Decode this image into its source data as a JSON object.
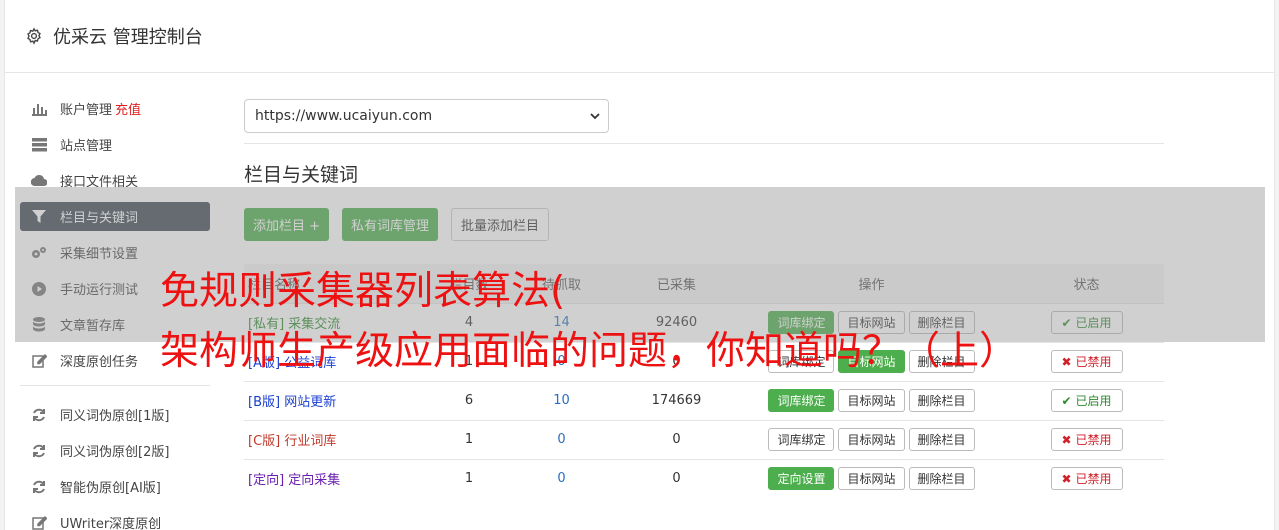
{
  "header": {
    "title": "优采云 管理控制台"
  },
  "sidebar": {
    "items": [
      {
        "label": "账户管理",
        "extra": "充值",
        "icon": "bar-chart-icon"
      },
      {
        "label": "站点管理",
        "icon": "server-icon"
      },
      {
        "label": "接口文件相关",
        "icon": "cloud-upload-icon"
      },
      {
        "label": "栏目与关键词",
        "icon": "filter-icon",
        "active": true
      },
      {
        "label": "采集细节设置",
        "icon": "cogs-icon"
      },
      {
        "label": "手动运行测试",
        "icon": "play-circle-icon"
      },
      {
        "label": "文章暂存库",
        "icon": "database-icon"
      },
      {
        "label": "深度原创任务",
        "icon": "edit-icon"
      }
    ],
    "items2": [
      {
        "label": "同义词伪原创[1版]",
        "icon": "refresh-icon"
      },
      {
        "label": "同义词伪原创[2版]",
        "icon": "refresh-icon"
      },
      {
        "label": "智能伪原创[AI版]",
        "icon": "refresh-icon"
      },
      {
        "label": "UWriter深度原创",
        "icon": "edit-icon"
      }
    ]
  },
  "main": {
    "site_select": "https://www.ucaiyun.com",
    "section_title": "栏目与关键词",
    "buttons": {
      "add": "添加栏目 +",
      "private": "私有词库管理",
      "batch": "批量添加栏目"
    },
    "table": {
      "headers": [
        "栏目名称",
        "栏目数",
        "待抓取",
        "已采集",
        "操作",
        "状态"
      ],
      "rows": [
        {
          "tag": "[私有]",
          "name": "采集交流",
          "cols": "4",
          "pending": "14",
          "collected": "92460",
          "op1": "词库绑定",
          "op2": "目标网站",
          "op3": "删除栏目",
          "status": "已启用"
        },
        {
          "tag": "[A版]",
          "name": "公益词库",
          "cols": "1",
          "pending": "0",
          "collected": "0",
          "op1": "词库绑定",
          "op2": "目标网站",
          "op3": "删除栏目",
          "status": "已禁用"
        },
        {
          "tag": "[B版]",
          "name": "网站更新",
          "cols": "6",
          "pending": "10",
          "collected": "174669",
          "op1": "词库绑定",
          "op2": "目标网站",
          "op3": "删除栏目",
          "status": "已启用"
        },
        {
          "tag": "[C版]",
          "name": "行业词库",
          "cols": "1",
          "pending": "0",
          "collected": "0",
          "op1": "词库绑定",
          "op2": "目标网站",
          "op3": "删除栏目",
          "status": "已禁用"
        },
        {
          "tag": "[定向]",
          "name": "定向采集",
          "cols": "1",
          "pending": "0",
          "collected": "0",
          "op1": "定向设置",
          "op2": "目标网站",
          "op3": "删除栏目",
          "status": "已禁用"
        }
      ]
    }
  },
  "watermark": {
    "line1": "免规则采集器列表算法(",
    "line2": "架构师生产级应用面临的问题，你知道吗？（上）"
  }
}
